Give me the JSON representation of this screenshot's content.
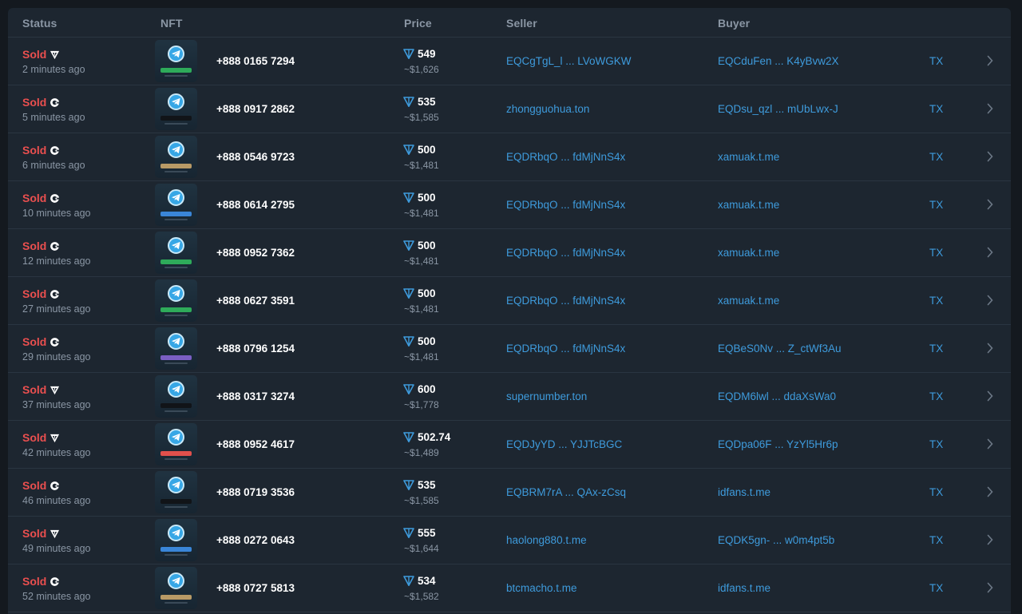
{
  "header": {
    "status": "Status",
    "nft": "NFT",
    "price": "Price",
    "seller": "Seller",
    "buyer": "Buyer"
  },
  "colors": {
    "sold": "#ea4f4f",
    "link": "#3e9bdc",
    "muted": "#8a96a4",
    "ton": "#3e9bdc"
  },
  "rows": [
    {
      "status": "Sold",
      "market_icon": "fragment-icon",
      "time": "2 minutes ago",
      "pill": "#2eab5a",
      "phone": "+888 0165 7294",
      "price": "549",
      "usd": "~$1,626",
      "seller": "EQCgTgL_l ... LVoWGKW",
      "buyer": "EQCduFen ... K4yBvw2X",
      "tx": "TX"
    },
    {
      "status": "Sold",
      "market_icon": "getgems-icon",
      "time": "5 minutes ago",
      "pill": "#111418",
      "phone": "+888 0917 2862",
      "price": "535",
      "usd": "~$1,585",
      "seller": "zhongguohua.ton",
      "buyer": "EQDsu_qzl ... mUbLwx-J",
      "tx": "TX"
    },
    {
      "status": "Sold",
      "market_icon": "getgems-icon",
      "time": "6 minutes ago",
      "pill": "#b89a66",
      "phone": "+888 0546 9723",
      "price": "500",
      "usd": "~$1,481",
      "seller": "EQDRbqO ... fdMjNnS4x",
      "buyer": "xamuak.t.me",
      "tx": "TX"
    },
    {
      "status": "Sold",
      "market_icon": "getgems-icon",
      "time": "10 minutes ago",
      "pill": "#3a86d8",
      "phone": "+888 0614 2795",
      "price": "500",
      "usd": "~$1,481",
      "seller": "EQDRbqO ... fdMjNnS4x",
      "buyer": "xamuak.t.me",
      "tx": "TX"
    },
    {
      "status": "Sold",
      "market_icon": "getgems-icon",
      "time": "12 minutes ago",
      "pill": "#2eab5a",
      "phone": "+888 0952 7362",
      "price": "500",
      "usd": "~$1,481",
      "seller": "EQDRbqO ... fdMjNnS4x",
      "buyer": "xamuak.t.me",
      "tx": "TX"
    },
    {
      "status": "Sold",
      "market_icon": "getgems-icon",
      "time": "27 minutes ago",
      "pill": "#2eab5a",
      "phone": "+888 0627 3591",
      "price": "500",
      "usd": "~$1,481",
      "seller": "EQDRbqO ... fdMjNnS4x",
      "buyer": "xamuak.t.me",
      "tx": "TX"
    },
    {
      "status": "Sold",
      "market_icon": "getgems-icon",
      "time": "29 minutes ago",
      "pill": "#7a5fc4",
      "phone": "+888 0796 1254",
      "price": "500",
      "usd": "~$1,481",
      "seller": "EQDRbqO ... fdMjNnS4x",
      "buyer": "EQBeS0Nv ... Z_ctWf3Au",
      "tx": "TX"
    },
    {
      "status": "Sold",
      "market_icon": "fragment-icon",
      "time": "37 minutes ago",
      "pill": "#111418",
      "phone": "+888 0317 3274",
      "price": "600",
      "usd": "~$1,778",
      "seller": "supernumber.ton",
      "buyer": "EQDM6lwl ... ddaXsWa0",
      "tx": "TX"
    },
    {
      "status": "Sold",
      "market_icon": "fragment-icon",
      "time": "42 minutes ago",
      "pill": "#e0504c",
      "phone": "+888 0952 4617",
      "price": "502.74",
      "usd": "~$1,489",
      "seller": "EQDJyYD ... YJJTcBGC",
      "buyer": "EQDpa06F ... YzYl5Hr6p",
      "tx": "TX"
    },
    {
      "status": "Sold",
      "market_icon": "getgems-icon",
      "time": "46 minutes ago",
      "pill": "#111418",
      "phone": "+888 0719 3536",
      "price": "535",
      "usd": "~$1,585",
      "seller": "EQBRM7rA ... QAx-zCsq",
      "buyer": "idfans.t.me",
      "tx": "TX"
    },
    {
      "status": "Sold",
      "market_icon": "fragment-icon",
      "time": "49 minutes ago",
      "pill": "#3a86d8",
      "phone": "+888 0272 0643",
      "price": "555",
      "usd": "~$1,644",
      "seller": "haolong880.t.me",
      "buyer": "EQDK5gn- ... w0m4pt5b",
      "tx": "TX"
    },
    {
      "status": "Sold",
      "market_icon": "getgems-icon",
      "time": "52 minutes ago",
      "pill": "#b89a66",
      "phone": "+888 0727 5813",
      "price": "534",
      "usd": "~$1,582",
      "seller": "btcmacho.t.me",
      "buyer": "idfans.t.me",
      "tx": "TX"
    }
  ]
}
